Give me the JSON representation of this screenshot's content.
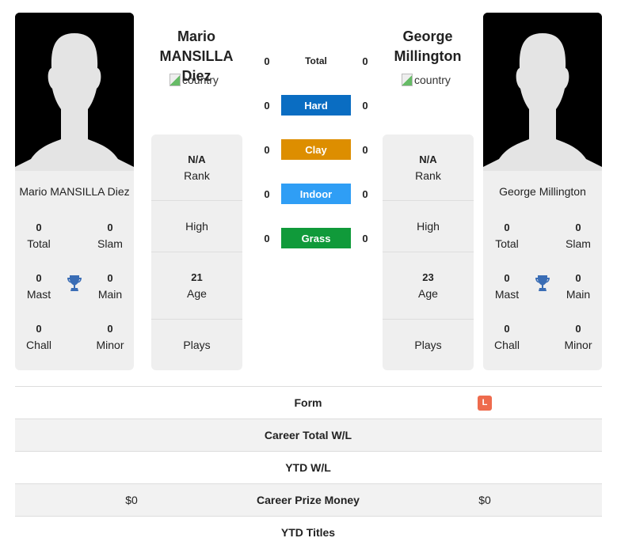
{
  "players": [
    {
      "name_line1": "Mario",
      "name_line2": "MANSILLA Diez",
      "full_name": "Mario MANSILLA Diez",
      "country_alt": "country",
      "rank": "N/A",
      "rank_label": "Rank",
      "high_label": "High",
      "age": "21",
      "age_label": "Age",
      "plays_label": "Plays",
      "titles": {
        "total": "0",
        "total_label": "Total",
        "slam": "0",
        "slam_label": "Slam",
        "mast": "0",
        "mast_label": "Mast",
        "main": "0",
        "main_label": "Main",
        "chall": "0",
        "chall_label": "Chall",
        "minor": "0",
        "minor_label": "Minor"
      }
    },
    {
      "name_line1": "George",
      "name_line2": "Millington",
      "full_name": "George Millington",
      "country_alt": "country",
      "rank": "N/A",
      "rank_label": "Rank",
      "high_label": "High",
      "age": "23",
      "age_label": "Age",
      "plays_label": "Plays",
      "titles": {
        "total": "0",
        "total_label": "Total",
        "slam": "0",
        "slam_label": "Slam",
        "mast": "0",
        "mast_label": "Mast",
        "main": "0",
        "main_label": "Main",
        "chall": "0",
        "chall_label": "Chall",
        "minor": "0",
        "minor_label": "Minor"
      }
    }
  ],
  "h2h": {
    "total": {
      "label": "Total",
      "p1": "0",
      "p2": "0"
    },
    "surfaces": [
      {
        "label": "Hard",
        "p1": "0",
        "p2": "0",
        "color": "#0a6dc2"
      },
      {
        "label": "Clay",
        "p1": "0",
        "p2": "0",
        "color": "#dd8e00"
      },
      {
        "label": "Indoor",
        "p1": "0",
        "p2": "0",
        "color": "#2f9ef5"
      },
      {
        "label": "Grass",
        "p1": "0",
        "p2": "0",
        "color": "#109a3a"
      }
    ]
  },
  "comparison": [
    {
      "label": "Form",
      "p1": "",
      "p2_badge": "L"
    },
    {
      "label": "Career Total W/L",
      "p1": "",
      "p2": ""
    },
    {
      "label": "YTD W/L",
      "p1": "",
      "p2": ""
    },
    {
      "label": "Career Prize Money",
      "p1": "$0",
      "p2": "$0"
    },
    {
      "label": "YTD Titles",
      "p1": "",
      "p2": ""
    }
  ],
  "colors": {
    "trophy": "#3a6db5",
    "form_loss": "#ee6b4d"
  }
}
